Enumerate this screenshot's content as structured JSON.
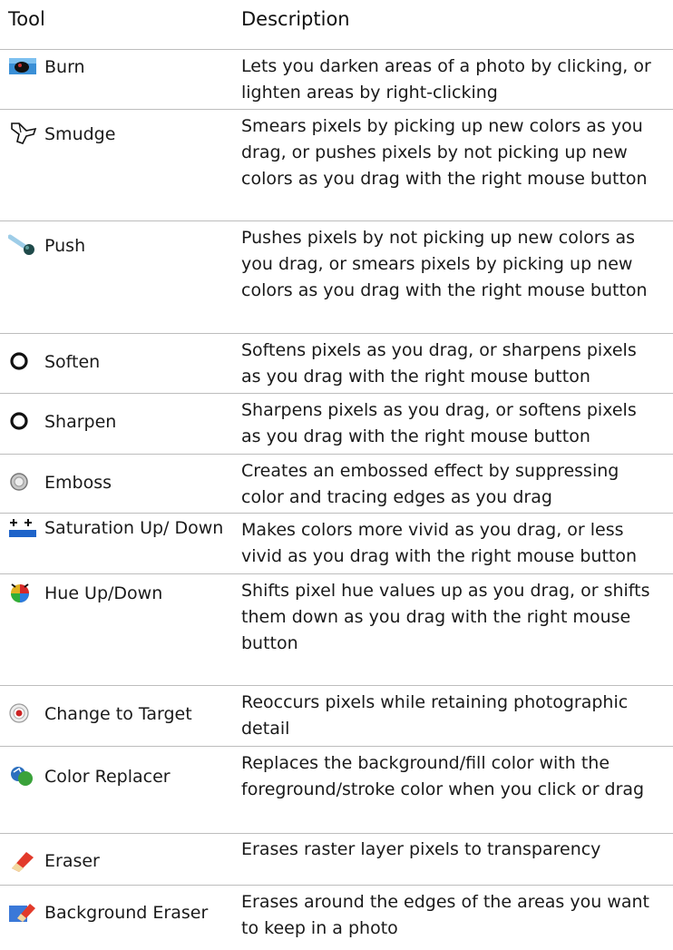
{
  "table": {
    "headers": {
      "tool": "Tool",
      "description": "Description"
    },
    "rows": [
      {
        "tool": "Burn",
        "icon": "burn-icon",
        "description": "Lets you darken areas of a photo by clicking, or lighten areas by right-clicking"
      },
      {
        "tool": "Smudge",
        "icon": "smudge-icon",
        "description": "Smears pixels by picking up new colors as you drag, or pushes pixels by not picking up new colors as you drag with the right mouse button"
      },
      {
        "tool": "Push",
        "icon": "push-icon",
        "description": "Pushes pixels by not picking up new colors as you drag, or smears pixels by picking up new colors as you drag with the right mouse button"
      },
      {
        "tool": "Soften",
        "icon": "soften-icon",
        "description": "Softens pixels as you drag, or sharpens pixels as you drag with the right mouse button"
      },
      {
        "tool": "Sharpen",
        "icon": "sharpen-icon",
        "description": "Sharpens pixels as you drag, or softens pixels as you drag with the right mouse button"
      },
      {
        "tool": "Emboss",
        "icon": "emboss-icon",
        "description": "Creates an embossed effect by suppressing color and tracing edges as you drag"
      },
      {
        "tool": "Saturation Up/ Down",
        "icon": "saturation-icon",
        "description": "Makes colors more vivid as you drag, or less vivid as you drag with the right mouse button"
      },
      {
        "tool": "Hue Up/Down",
        "icon": "hue-icon",
        "description": "Shifts pixel hue values up as you drag, or shifts them down as you drag with the right mouse button"
      },
      {
        "tool": "Change to Target",
        "icon": "target-icon",
        "description": "Reoccurs pixels while retaining photographic detail"
      },
      {
        "tool": "Color Replacer",
        "icon": "color-replacer-icon",
        "description": "Replaces the background/fill color with the foreground/stroke color when you click or drag"
      },
      {
        "tool": "Eraser",
        "icon": "eraser-icon",
        "description": "Erases raster layer pixels to transparency"
      },
      {
        "tool": "Background Eraser",
        "icon": "background-eraser-icon",
        "description": "Erases around the edges of the areas you want to keep in a photo"
      }
    ]
  }
}
